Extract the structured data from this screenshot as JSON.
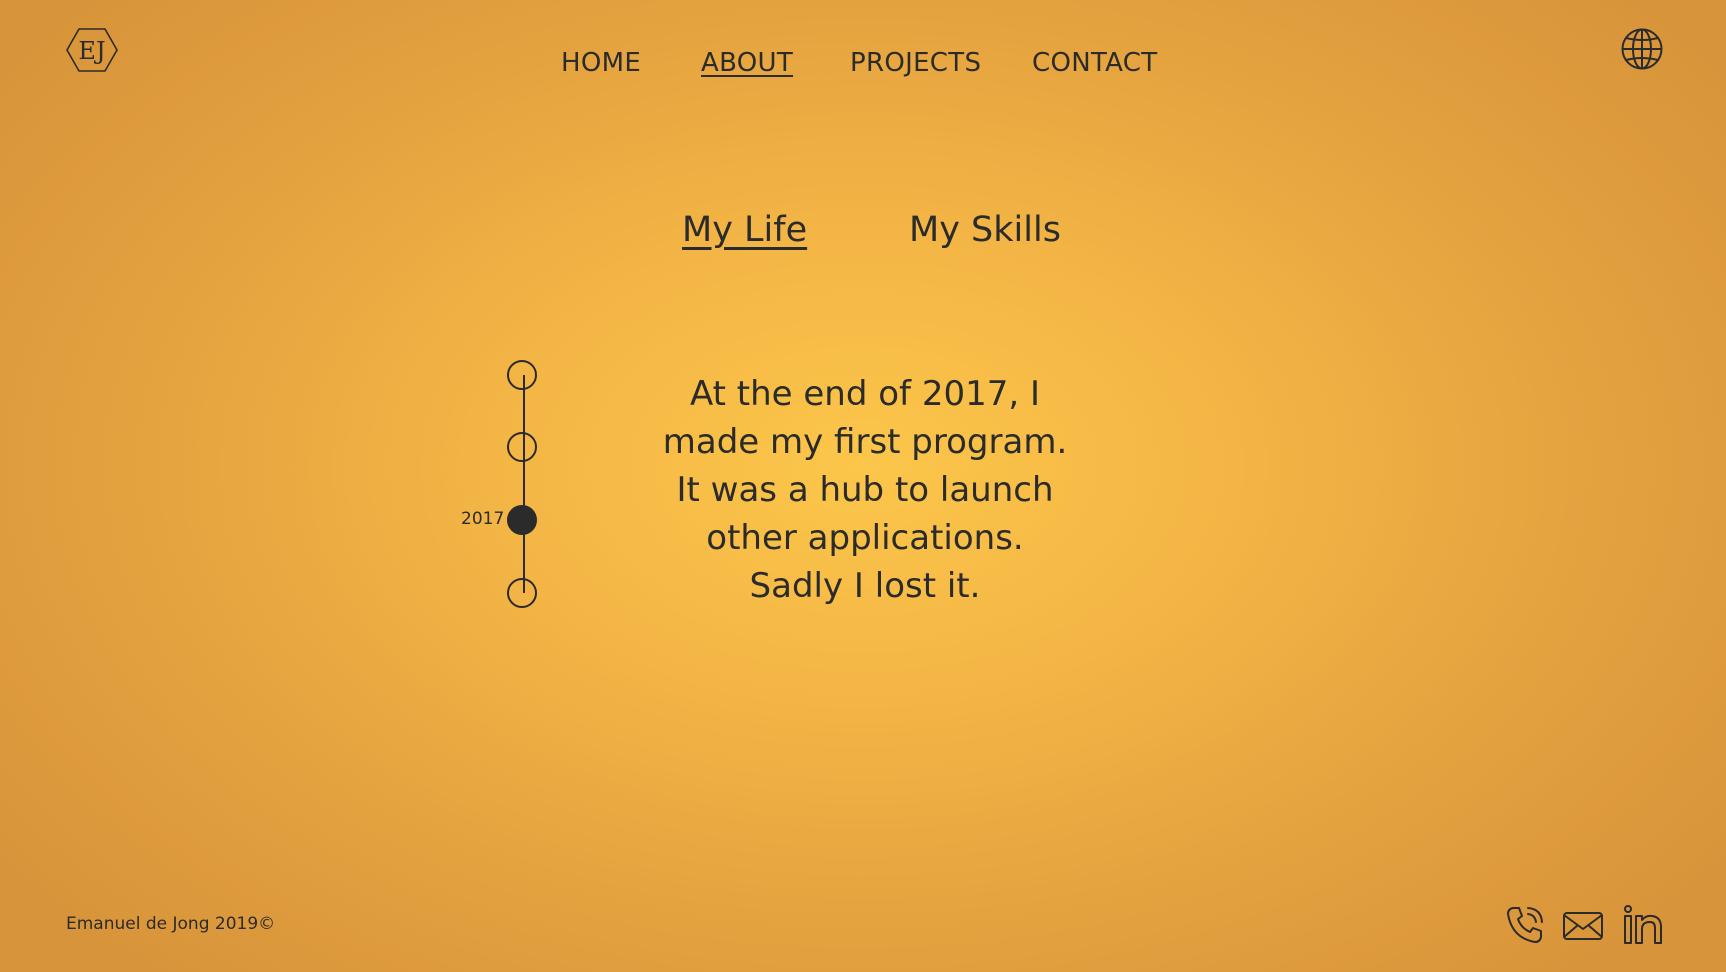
{
  "brand": {
    "logo_text": "EJ"
  },
  "nav": {
    "items": [
      {
        "label": "HOME",
        "active": false
      },
      {
        "label": "ABOUT",
        "active": true
      },
      {
        "label": "PROJECTS",
        "active": false
      },
      {
        "label": "CONTACT",
        "active": false
      }
    ]
  },
  "language_icon": "globe-icon",
  "tabs": [
    {
      "label": "My Life",
      "active": true
    },
    {
      "label": "My Skills",
      "active": false
    }
  ],
  "timeline": {
    "selected_year": "2017",
    "node_count": 4,
    "selected_index": 2
  },
  "story": {
    "lines": [
      "At the end of 2017, I",
      "made my first program.",
      "It was a hub to launch",
      "other applications.",
      "Sadly I lost it."
    ]
  },
  "footer": {
    "copyright": "Emanuel de Jong 2019©",
    "contact_icons": [
      "phone-icon",
      "mail-icon",
      "linkedin-icon"
    ]
  },
  "colors": {
    "text": "#2b2b2b",
    "background_center": "#fcc64a",
    "background_edge": "#d8943a"
  }
}
